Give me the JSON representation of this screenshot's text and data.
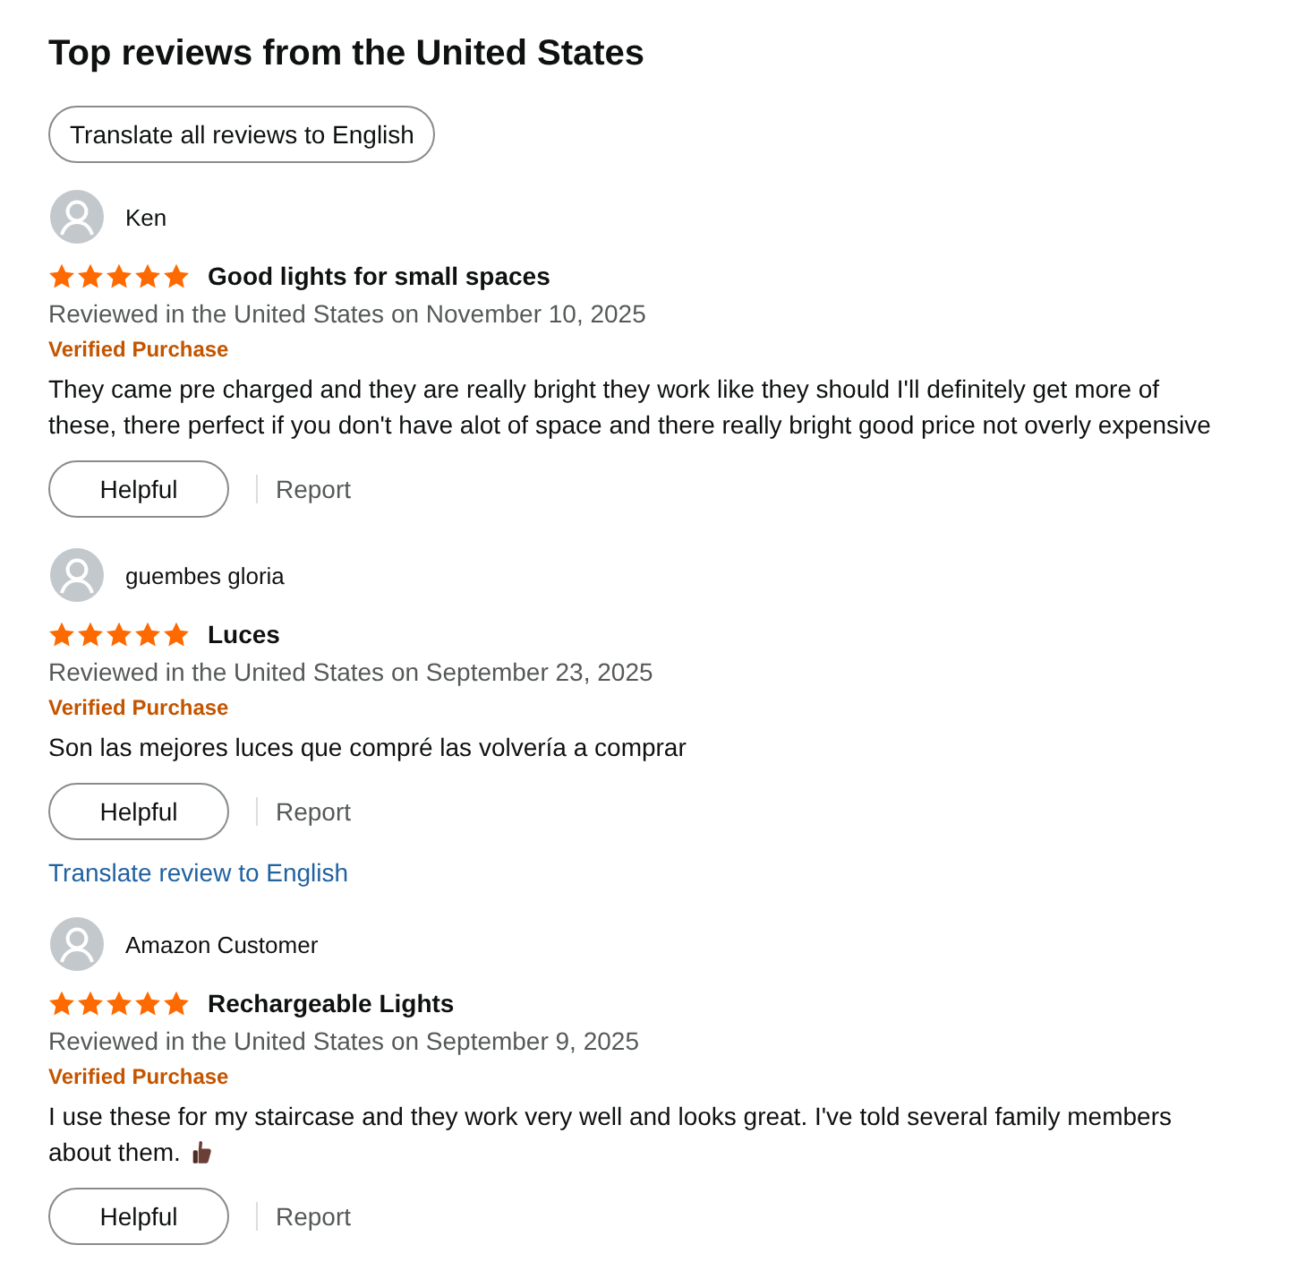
{
  "heading": "Top reviews from the United States",
  "translate_all_button": "Translate all reviews to English",
  "reviews": [
    {
      "author": "Ken",
      "stars": 5,
      "title": "Good lights for small spaces",
      "meta": "Reviewed in the United States on November 10, 2025",
      "badge": "Verified Purchase",
      "body": "They came pre charged and they are really bright they work like they should I'll definitely get more of these, there perfect if you don't have alot of space and there really bright good price not overly expensive",
      "thumbs_up_emoji": false,
      "helpful": "Helpful",
      "report": "Report"
    },
    {
      "author": "guembes gloria",
      "stars": 5,
      "title": "Luces",
      "meta": "Reviewed in the United States on September 23, 2025",
      "badge": "Verified Purchase",
      "body": "Son las mejores luces que compré las volvería a comprar",
      "thumbs_up_emoji": false,
      "helpful": "Helpful",
      "report": "Report",
      "translate_link": "Translate review to English"
    },
    {
      "author": "Amazon Customer",
      "stars": 5,
      "title": "Rechargeable Lights",
      "meta": "Reviewed in the United States on September 9, 2025",
      "badge": "Verified Purchase",
      "body": "I use these for my staircase and they work very well and looks great. I've told several family members about them.",
      "thumbs_up_emoji": true,
      "helpful": "Helpful",
      "report": "Report"
    }
  ]
}
